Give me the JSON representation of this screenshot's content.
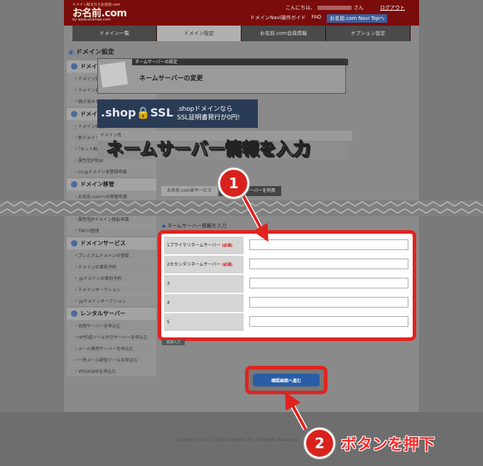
{
  "header": {
    "tagline": "ドメイン取るならお名前.com",
    "logo": "お名前.com",
    "logo_url": "by www.onamae.com",
    "hello": "こんにちは、",
    "hello_suffix": "さん",
    "logout": "ログアウト",
    "links": [
      "ドメインNavi操作ガイド",
      "FAQ",
      "お名前.com Navi Topへ"
    ]
  },
  "tabs": [
    "ドメイン一覧",
    "ドメイン設定",
    "お名前.com会員情報",
    "オプション設定"
  ],
  "active_tab_index": 1,
  "sidebar": {
    "title": "ドメイン設定",
    "sections": [
      {
        "title": "ドメイン更新",
        "items": [
          "ドメイン契約更新",
          "ドメイン自動更新設定",
          "廃止済みドメイン復旧"
        ]
      },
      {
        "title": "ドメイン登録",
        "items": [
          "ドメインの登録",
          "新ドメインの登録",
          "「セット割」",
          "属性型JP登録",
          "co.jpドメイン本登録申請"
        ]
      },
      {
        "title": "ドメイン移管",
        "items": [
          "お名前.comへの移管申請",
          "お名前.comへの移管状況確認",
          "属性型JPドメイン移転申請",
          "TMCH管理"
        ]
      },
      {
        "title": "ドメインサービス",
        "items": [
          "プレミアムドメインの登録",
          "ドメインの事前予約",
          ".jpドメインの事前予約",
          "ドメインオークション",
          ".jpドメインオークション"
        ]
      },
      {
        "title": "レンタルサーバー",
        "items": [
          "共用サーバーを申込む",
          "HP作成ツール付きサーバーを申込む",
          "メール専用サーバーを申込む",
          "一斉メール配信ツールを申込む",
          "VPS(KVM)を申込む"
        ]
      }
    ]
  },
  "main": {
    "box_caption": "ネームサーバーの設定",
    "box_title": "ネームサーバーの変更",
    "banner_logo": ".shop🔒SSL",
    "banner_text_1": ".shopドメインなら",
    "banner_text_2": "SSL証明書発行が0円!",
    "mid_caption": "ドメイン名",
    "subtabs": [
      "お名前.com各サービス",
      "他のネームサーバーを利用"
    ],
    "form_heading": "ネームサーバー情報を入力",
    "rows": [
      {
        "label": "1プライマリネームサーバー",
        "required": "(必須)",
        "value": ""
      },
      {
        "label": "2セカンダリネームサーバー",
        "required": "(必須)",
        "value": ""
      },
      {
        "label": "3",
        "required": "",
        "value": ""
      },
      {
        "label": "4",
        "required": "",
        "value": ""
      },
      {
        "label": "5",
        "required": "",
        "value": ""
      }
    ],
    "small_button": "追加入力",
    "confirm_button": "確認画面へ進む"
  },
  "footer": {
    "copyright": "Copyright (c) 2017 GMO Internet, Inc. All Rights Reserved."
  },
  "annotations": {
    "step1_number": "1",
    "step1_text": "ネームサーバー情報を入力",
    "step2_number": "2",
    "step2_text": "ボタンを押下"
  },
  "colors": {
    "annotation_red": "#e0231f",
    "confirm_blue": "#2a5da6",
    "header_red": "#7a0c0c"
  }
}
